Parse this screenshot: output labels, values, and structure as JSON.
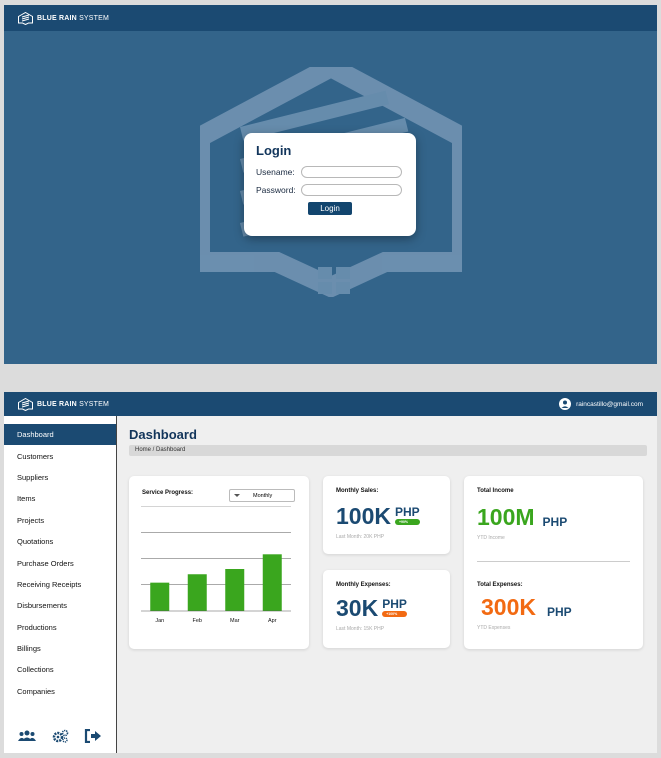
{
  "brand": {
    "bold": "BLUE RAIN",
    "rest": " SYSTEM"
  },
  "login": {
    "title": "Login",
    "username_label": "Usename:",
    "password_label": "Password:",
    "button": "Login"
  },
  "header": {
    "user_email": "raincastillo@gmail.com"
  },
  "sidebar": {
    "items": [
      {
        "label": "Dashboard"
      },
      {
        "label": "Customers"
      },
      {
        "label": "Suppliers"
      },
      {
        "label": "Items"
      },
      {
        "label": "Projects"
      },
      {
        "label": "Quotations"
      },
      {
        "label": "Purchase Orders"
      },
      {
        "label": "Receiving Receipts"
      },
      {
        "label": "Disbursements"
      },
      {
        "label": "Productions"
      },
      {
        "label": "Billings"
      },
      {
        "label": "Collections"
      },
      {
        "label": "Companies"
      }
    ],
    "bottom_icons": [
      "users-icon",
      "settings-icon",
      "logout-icon"
    ]
  },
  "main": {
    "title": "Dashboard",
    "breadcrumb": "Home / Dashboard"
  },
  "service_progress": {
    "label": "Service Progress:",
    "period": "Monthly"
  },
  "chart_data": {
    "type": "bar",
    "categories": [
      "Jan",
      "Feb",
      "Mar",
      "Apr"
    ],
    "values": [
      27,
      35,
      40,
      54
    ],
    "ylim": [
      0,
      100
    ],
    "grid": true,
    "color": "#3aa61e"
  },
  "monthly_sales": {
    "label": "Monthly Sales:",
    "value": "100K",
    "unit": "PHP",
    "badge": "+90%",
    "sub": "Last Month: 20K PHP"
  },
  "monthly_expenses": {
    "label": "Monthly Expenses:",
    "value": "30K",
    "unit": "PHP",
    "badge": "+100%",
    "sub": "Last Month: 15K PHP"
  },
  "total_income": {
    "label": "Total Income",
    "value": "100M",
    "unit": "PHP",
    "sub": "YTD Income"
  },
  "total_expenses": {
    "label": "Total Expenses:",
    "value": "300K",
    "unit": "PHP",
    "sub": "YTD Expenses"
  },
  "colors": {
    "navy": "#1b4a72",
    "green": "#3aa61e",
    "orange": "#f26a12",
    "title": "#12355b"
  }
}
